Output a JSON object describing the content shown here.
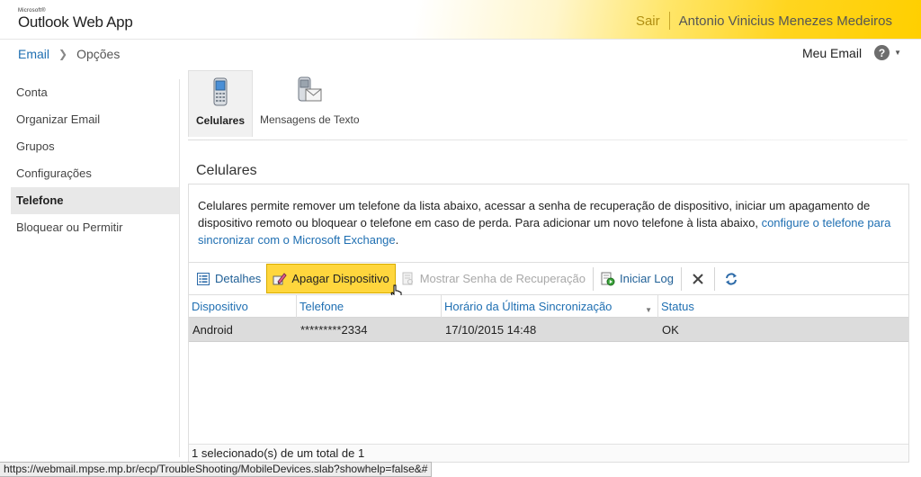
{
  "header": {
    "logo_small": "Microsoft®",
    "logo_main": "Outlook Web App",
    "signout": "Sair",
    "username": "Antonio Vinicius Menezes Medeiros"
  },
  "breadcrumb": {
    "root": "Email",
    "current": "Opções"
  },
  "top_right": {
    "my_mail": "Meu Email",
    "help_icon": "help-icon",
    "help_symbol": "?",
    "caret_symbol": "▼"
  },
  "nav": {
    "items": [
      {
        "label": "Conta"
      },
      {
        "label": "Organizar Email"
      },
      {
        "label": "Grupos"
      },
      {
        "label": "Configurações"
      },
      {
        "label": "Telefone",
        "selected": true
      },
      {
        "label": "Bloquear ou Permitir"
      }
    ]
  },
  "tabs": [
    {
      "label": "Celulares",
      "icon": "mobile-phone-icon",
      "active": true
    },
    {
      "label": "Mensagens de Texto",
      "icon": "text-message-icon",
      "active": false
    }
  ],
  "section": {
    "title": "Celulares",
    "description": "Celulares permite remover um telefone da lista abaixo, acessar a senha de recuperação de dispositivo, iniciar um apagamento de dispositivo remoto ou bloquear o telefone em caso de perda. Para adicionar um novo telefone à lista abaixo, ",
    "description_link": "configure o telefone para sincronizar com o Microsoft Exchange",
    "description_end": "."
  },
  "toolbar": {
    "details_label": "Detalhes",
    "wipe_label": "Apagar Dispositivo",
    "recovery_label": "Mostrar Senha de Recuperação",
    "log_label": "Iniciar Log",
    "delete_icon": "delete-x-icon",
    "refresh_icon": "refresh-icon"
  },
  "table": {
    "columns": [
      "Dispositivo",
      "Telefone",
      "Horário da Última Sincronização",
      "Status"
    ],
    "rows": [
      {
        "device": "Android",
        "phone": "*********2334",
        "last_sync": "17/10/2015 14:48",
        "status": "OK"
      }
    ],
    "footer": "1 selecionado(s) de um total de 1"
  },
  "statusbar": {
    "url": "https://webmail.mpse.mp.br/ecp/TroubleShooting/MobileDevices.slab?showhelp=false&#"
  },
  "colors": {
    "accent": "#1f6fb2",
    "highlight": "#ffd63d",
    "header_gold": "#ffcf00"
  }
}
